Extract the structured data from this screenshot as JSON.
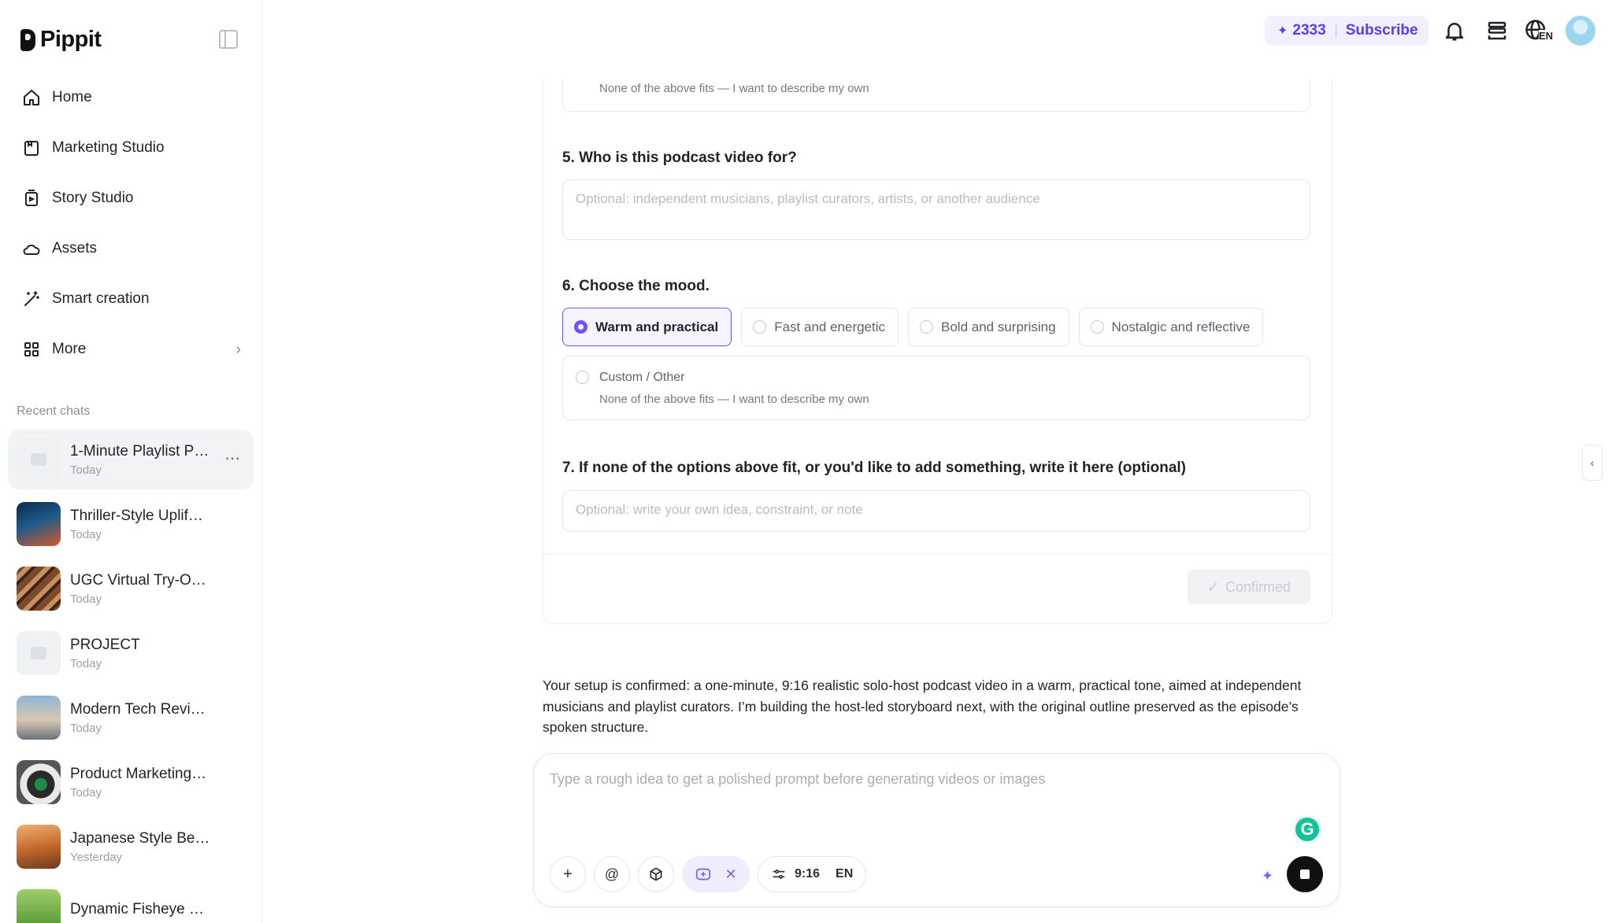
{
  "app": {
    "name": "Pippit"
  },
  "sidebar": {
    "nav": [
      {
        "label": "Home",
        "icon": "home-icon"
      },
      {
        "label": "Marketing Studio",
        "icon": "calendar-icon"
      },
      {
        "label": "Story Studio",
        "icon": "book-icon"
      },
      {
        "label": "Assets",
        "icon": "cloud-icon"
      },
      {
        "label": "Smart creation",
        "icon": "magic-wand-icon"
      },
      {
        "label": "More",
        "icon": "grid-icon"
      }
    ],
    "recent_title": "Recent chats",
    "chats": [
      {
        "title": "1-Minute Playlist P…",
        "time": "Today"
      },
      {
        "title": "Thriller-Style Uplif…",
        "time": "Today"
      },
      {
        "title": "UGC Virtual Try-O…",
        "time": "Today"
      },
      {
        "title": "PROJECT",
        "time": "Today"
      },
      {
        "title": "Modern Tech Revi…",
        "time": "Today"
      },
      {
        "title": "Product Marketing…",
        "time": "Today"
      },
      {
        "title": "Japanese Style Be…",
        "time": "Yesterday"
      },
      {
        "title": "Dynamic Fisheye …",
        "time": ""
      }
    ],
    "more_dots": "⋯"
  },
  "header": {
    "credits": "2333",
    "subscribe": "Subscribe",
    "lang": "EN"
  },
  "form": {
    "prev_custom_desc": "None of the above fits — I want to describe my own",
    "q5": {
      "title": "5. Who is this podcast video for?",
      "placeholder": "Optional: independent musicians, playlist curators, artists, or another audience"
    },
    "q6": {
      "title": "6. Choose the mood.",
      "options": [
        "Warm and practical",
        "Fast and energetic",
        "Bold and surprising",
        "Nostalgic and reflective"
      ],
      "selected": "Warm and practical",
      "custom_title": "Custom / Other",
      "custom_desc": "None of the above fits — I want to describe my own"
    },
    "q7": {
      "title": "7. If none of the options above fit, or you'd like to add something, write it here (optional)",
      "placeholder": "Optional: write your own idea, constraint, or note"
    },
    "confirm_label": "Confirmed"
  },
  "assistant_message": "Your setup is confirmed: a one-minute, 9:16 realistic solo-host podcast video in a warm, practical tone, aimed at independent musicians and playlist curators. I’m building the host-led storyboard next, with the original outline preserved as the episode’s spoken structure.",
  "composer": {
    "placeholder": "Type a rough idea to get a polished prompt before generating videos or images",
    "ratio": "9:16",
    "lang": "EN"
  },
  "colors": {
    "accent": "#6e52f5",
    "accent_bg": "#f2f0ff"
  }
}
